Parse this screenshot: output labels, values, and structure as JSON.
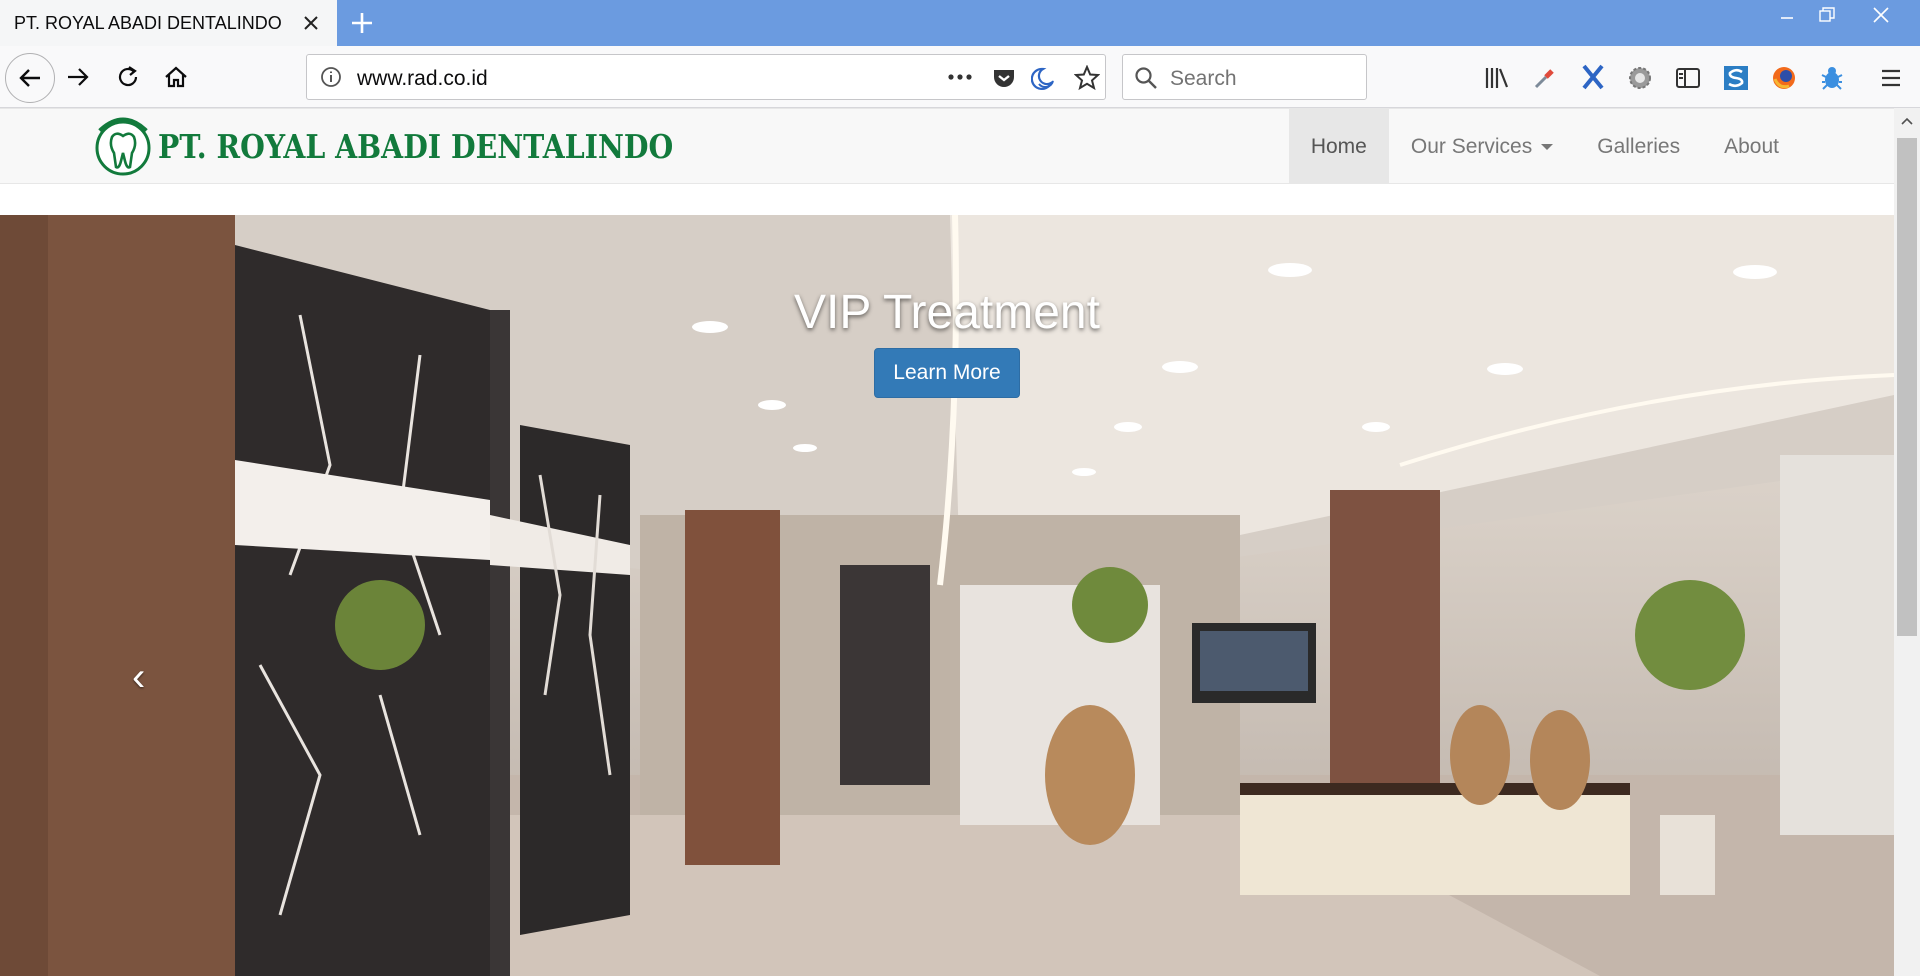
{
  "browser": {
    "tab_title": "PT. ROYAL ABADI DENTALINDO",
    "tab_close_icon": "close-icon",
    "new_tab_label": "+",
    "url": "www.rad.co.id",
    "search_placeholder": "Search",
    "toolbar_icons": [
      "back-icon",
      "forward-icon",
      "reload-icon",
      "home-icon",
      "info-icon",
      "page-actions-icon",
      "pocket-icon",
      "moon-icon",
      "bookmark-star-icon",
      "library-icon",
      "eyedropper-icon",
      "x-extension-icon",
      "gear-extension-icon",
      "sidebar-icon",
      "s-extension-icon",
      "firefox-icon",
      "bug-extension-icon",
      "menu-icon"
    ],
    "accent_color": "#6b9be0"
  },
  "site": {
    "brand": "PT. ROYAL ABADI DENTALINDO",
    "brand_color": "#127a3c",
    "nav": [
      {
        "label": "Home",
        "active": true
      },
      {
        "label": "Our Services",
        "dropdown": true
      },
      {
        "label": "Galleries"
      },
      {
        "label": "About"
      }
    ]
  },
  "carousel": {
    "title": "VIP Treatment",
    "button_label": "Learn More",
    "prev_symbol": "‹",
    "button_color": "#337ab7"
  }
}
